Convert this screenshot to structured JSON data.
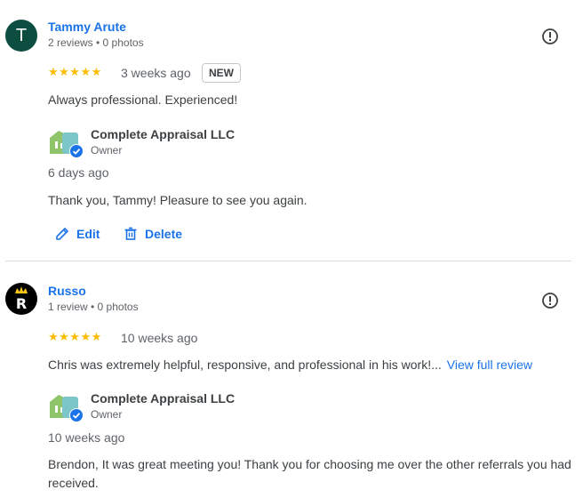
{
  "reviews": [
    {
      "reviewer_name": "Tammy Arute",
      "avatar_letter": "T",
      "reviewer_meta": "2 reviews • 0 photos",
      "stars": "★★★★★",
      "time_ago": "3 weeks ago",
      "badge": "NEW",
      "text": "Always professional. Experienced!",
      "owner": {
        "name": "Complete Appraisal LLC",
        "role": "Owner",
        "date": "6 days ago",
        "reply": "Thank you, Tammy! Pleasure to see you again."
      },
      "actions": {
        "edit_label": "Edit",
        "delete_label": "Delete"
      }
    },
    {
      "reviewer_name": "Russo",
      "reviewer_meta": "1 review • 0 photos",
      "stars": "★★★★★",
      "time_ago": "10 weeks ago",
      "text": "Chris was extremely helpful, responsive, and professional in his work!...",
      "view_full_label": "View full review",
      "owner": {
        "name": "Complete Appraisal LLC",
        "role": "Owner",
        "date": "10 weeks ago",
        "reply": "Brendon, It was great meeting you! Thank you for choosing me over the other referrals you had received."
      }
    }
  ],
  "icons": {
    "report": "exclamation-circle-icon",
    "edit": "pencil-icon",
    "delete": "trash-icon",
    "verified": "verified-check-icon"
  },
  "colors": {
    "link": "#1a73e8",
    "star": "#fbbc04",
    "avatar_bg": "#0d4d3f",
    "text": "#3c4043",
    "muted": "#5f6368"
  }
}
